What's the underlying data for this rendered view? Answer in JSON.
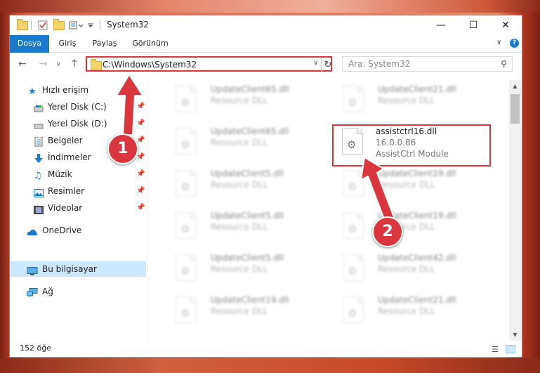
{
  "window": {
    "title": "System32",
    "minimize_glyph": "—",
    "maximize_glyph": "☐",
    "close_glyph": "✕"
  },
  "ribbon": {
    "tabs": [
      "Dosya",
      "Giriş",
      "Paylaş",
      "Görünüm"
    ]
  },
  "navigation": {
    "address": "C:\\Windows\\System32",
    "search_placeholder": "Ara: System32"
  },
  "sidebar": {
    "items": [
      {
        "label": "Hızlı erişim",
        "icon": "star-icon",
        "pinned": false
      },
      {
        "label": "Yerel Disk (C:)",
        "icon": "drive-icon",
        "pinned": true
      },
      {
        "label": "Yerel Disk (D:)",
        "icon": "drive-icon",
        "pinned": true
      },
      {
        "label": "Belgeler",
        "icon": "documents-icon",
        "pinned": true
      },
      {
        "label": "İndirmeler",
        "icon": "download-icon",
        "pinned": true
      },
      {
        "label": "Müzik",
        "icon": "music-icon",
        "pinned": true
      },
      {
        "label": "Resimler",
        "icon": "pictures-icon",
        "pinned": true
      },
      {
        "label": "Videolar",
        "icon": "videos-icon",
        "pinned": true
      },
      {
        "label": "OneDrive",
        "icon": "cloud-icon",
        "pinned": false
      },
      {
        "label": "Bu bilgisayar",
        "icon": "computer-icon",
        "pinned": false
      },
      {
        "label": "Ağ",
        "icon": "network-icon",
        "pinned": false
      }
    ]
  },
  "files": [
    {
      "name": "UpdateClient65.dll",
      "desc": "Resource DLL",
      "highlighted": false
    },
    {
      "name": "UpdateClient21.dll",
      "desc": "Resource DLL",
      "highlighted": false
    },
    {
      "name": "UpdateClient65.dll",
      "desc": "Resource DLL",
      "highlighted": false
    },
    {
      "name": "assistctrl16.dll",
      "version": "16.0.0.86",
      "desc": "AssistCtrl Module",
      "highlighted": true
    },
    {
      "name": "UpdateClient5.dll",
      "desc": "Resource DLL",
      "highlighted": false
    },
    {
      "name": "UpdateClient19.dll",
      "desc": "Resource DLL",
      "highlighted": false
    },
    {
      "name": "UpdateClient5.dll",
      "desc": "Resource DLL",
      "highlighted": false
    },
    {
      "name": "UpdateClient19.dll",
      "desc": "Resource DLL",
      "highlighted": false
    },
    {
      "name": "UpdateClient5.dll",
      "desc": "Resource DLL",
      "highlighted": false
    },
    {
      "name": "UpdateClient42.dll",
      "desc": "Resource DLL",
      "highlighted": false
    },
    {
      "name": "UpdateClient19.dll",
      "desc": "Resource DLL",
      "highlighted": false
    },
    {
      "name": "UpdateClient21.dll",
      "desc": "Resource DLL",
      "highlighted": false
    }
  ],
  "status": {
    "item_count": "152 öğe"
  },
  "annotations": {
    "step1": "1",
    "step2": "2",
    "color": "#d9363e"
  },
  "colors": {
    "accent": "#1979ca",
    "selection": "#cce8ff"
  }
}
